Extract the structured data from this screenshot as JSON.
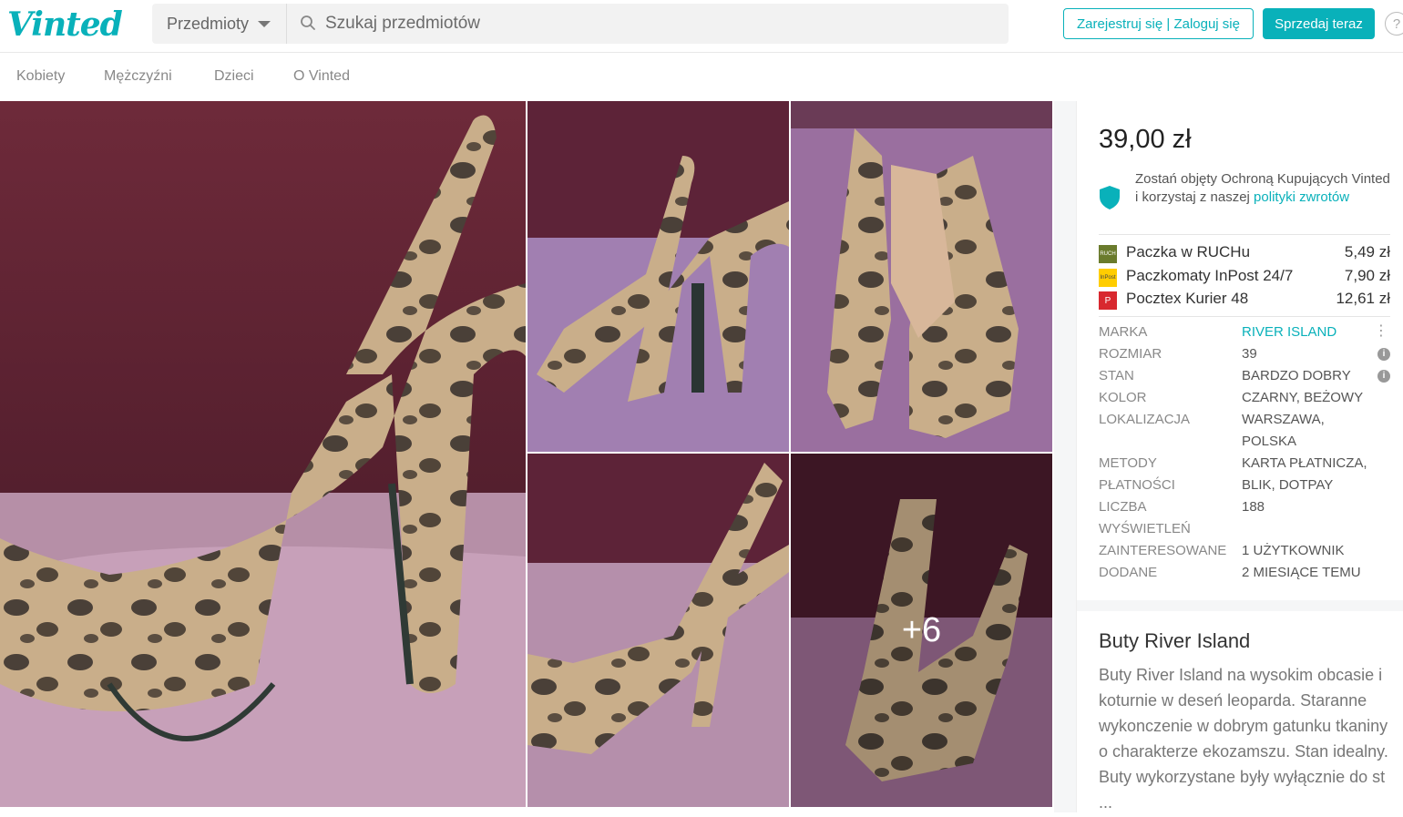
{
  "header": {
    "logo": "Vinted",
    "category_select": "Przedmioty",
    "search_placeholder": "Szukaj przedmiotów",
    "login_button": "Zarejestruj się | Zaloguj się",
    "sell_button": "Sprzedaj teraz",
    "help": "?"
  },
  "nav": {
    "items": [
      "Kobiety",
      "Mężczyźni",
      "Dzieci",
      "O Vinted"
    ]
  },
  "gallery": {
    "more_count": "+6"
  },
  "listing": {
    "price": "39,00 zł",
    "protection_text": "Zostań objęty Ochroną Kupujących Vinted i korzystaj z naszej ",
    "protection_link": "polityki zwrotów",
    "shipping": [
      {
        "name": "Paczka w RUCHu",
        "price": "5,49 zł",
        "logo": "RUCH",
        "color": "#6a7b2c"
      },
      {
        "name": "Paczkomaty InPost 24/7",
        "price": "7,90 zł",
        "logo": "InPost",
        "color": "#ffcd00"
      },
      {
        "name": "Pocztex Kurier 48",
        "price": "12,61 zł",
        "logo": "P",
        "color": "#d8282f"
      }
    ],
    "details": [
      {
        "label": "MARKA",
        "value": "RIVER ISLAND"
      },
      {
        "label": "ROZMIAR",
        "value": "39"
      },
      {
        "label": "STAN",
        "value": "BARDZO DOBRY"
      },
      {
        "label": "KOLOR",
        "value": "CZARNY, BEŻOWY"
      },
      {
        "label": "LOKALIZACJA",
        "value": "WARSZAWA, POLSKA"
      },
      {
        "label": "METODY PŁATNOŚCI",
        "value": "KARTA PŁATNICZA, BLIK, DOTPAY"
      },
      {
        "label": "LICZBA WYŚWIETLEŃ",
        "value": "188"
      },
      {
        "label": "ZAINTERESOWANE",
        "value": "1 UŻYTKOWNIK"
      },
      {
        "label": "DODANE",
        "value": "2 MIESIĄCE TEMU"
      }
    ],
    "title": "Buty River Island",
    "description": "Buty River Island na wysokim obcasie i koturnie w deseń leoparda. Staranne wykonczenie w dobrym gatunku tkaniny o charakterze ekozamszu. Stan idealny. Buty wykorzystane były wyłącznie do st ..."
  },
  "colors": {
    "accent": "#09b1ba"
  }
}
